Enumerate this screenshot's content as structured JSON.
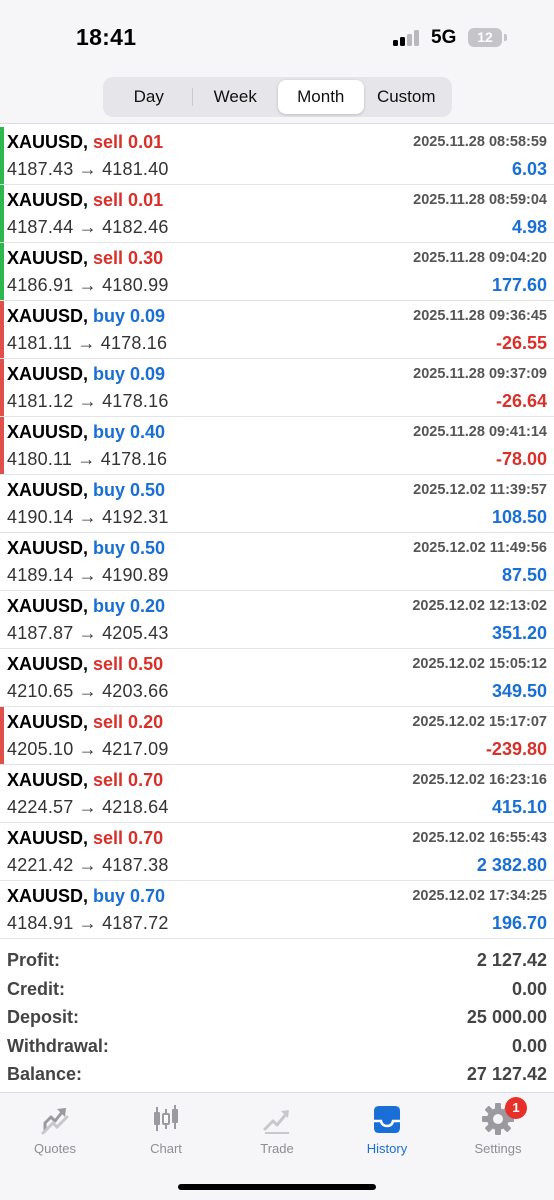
{
  "status_bar": {
    "time": "18:41",
    "network": "5G",
    "battery": "12"
  },
  "period_tabs": [
    {
      "label": "Day",
      "active": false
    },
    {
      "label": "Week",
      "active": false
    },
    {
      "label": "Month",
      "active": true
    },
    {
      "label": "Custom",
      "active": false
    }
  ],
  "deals": [
    {
      "symbol": "XAUUSD",
      "type_volume": "sell 0.01",
      "type": "sell",
      "prices": "4187.43 → 4181.40",
      "date": "2025.11.28 08:58:59",
      "profit": "6.03",
      "profit_sign": "pos",
      "side_color": "#2db84d"
    },
    {
      "symbol": "XAUUSD",
      "type_volume": "sell 0.01",
      "type": "sell",
      "prices": "4187.44 → 4182.46",
      "date": "2025.11.28 08:59:04",
      "profit": "4.98",
      "profit_sign": "pos",
      "side_color": "#2db84d"
    },
    {
      "symbol": "XAUUSD",
      "type_volume": "sell 0.30",
      "type": "sell",
      "prices": "4186.91 → 4180.99",
      "date": "2025.11.28 09:04:20",
      "profit": "177.60",
      "profit_sign": "pos",
      "side_color": "#2db84d"
    },
    {
      "symbol": "XAUUSD",
      "type_volume": "buy 0.09",
      "type": "buy",
      "prices": "4181.11 → 4178.16",
      "date": "2025.11.28 09:36:45",
      "profit": "-26.55",
      "profit_sign": "neg",
      "side_color": "#e0504a"
    },
    {
      "symbol": "XAUUSD",
      "type_volume": "buy 0.09",
      "type": "buy",
      "prices": "4181.12 → 4178.16",
      "date": "2025.11.28 09:37:09",
      "profit": "-26.64",
      "profit_sign": "neg",
      "side_color": "#e0504a"
    },
    {
      "symbol": "XAUUSD",
      "type_volume": "buy 0.40",
      "type": "buy",
      "prices": "4180.11 → 4178.16",
      "date": "2025.11.28 09:41:14",
      "profit": "-78.00",
      "profit_sign": "neg",
      "side_color": "#e0504a"
    },
    {
      "symbol": "XAUUSD",
      "type_volume": "buy 0.50",
      "type": "buy",
      "prices": "4190.14 → 4192.31",
      "date": "2025.12.02 11:39:57",
      "profit": "108.50",
      "profit_sign": "pos",
      "side_color": ""
    },
    {
      "symbol": "XAUUSD",
      "type_volume": "buy 0.50",
      "type": "buy",
      "prices": "4189.14 → 4190.89",
      "date": "2025.12.02 11:49:56",
      "profit": "87.50",
      "profit_sign": "pos",
      "side_color": ""
    },
    {
      "symbol": "XAUUSD",
      "type_volume": "buy 0.20",
      "type": "buy",
      "prices": "4187.87 → 4205.43",
      "date": "2025.12.02 12:13:02",
      "profit": "351.20",
      "profit_sign": "pos",
      "side_color": ""
    },
    {
      "symbol": "XAUUSD",
      "type_volume": "sell 0.50",
      "type": "sell",
      "prices": "4210.65 → 4203.66",
      "date": "2025.12.02 15:05:12",
      "profit": "349.50",
      "profit_sign": "pos",
      "side_color": ""
    },
    {
      "symbol": "XAUUSD",
      "type_volume": "sell 0.20",
      "type": "sell",
      "prices": "4205.10 → 4217.09",
      "date": "2025.12.02 15:17:07",
      "profit": "-239.80",
      "profit_sign": "neg",
      "side_color": "#e0504a"
    },
    {
      "symbol": "XAUUSD",
      "type_volume": "sell 0.70",
      "type": "sell",
      "prices": "4224.57 → 4218.64",
      "date": "2025.12.02 16:23:16",
      "profit": "415.10",
      "profit_sign": "pos",
      "side_color": ""
    },
    {
      "symbol": "XAUUSD",
      "type_volume": "sell 0.70",
      "type": "sell",
      "prices": "4221.42 → 4187.38",
      "date": "2025.12.02 16:55:43",
      "profit": "2 382.80",
      "profit_sign": "pos",
      "side_color": ""
    },
    {
      "symbol": "XAUUSD",
      "type_volume": "buy 0.70",
      "type": "buy",
      "prices": "4184.91 → 4187.72",
      "date": "2025.12.02 17:34:25",
      "profit": "196.70",
      "profit_sign": "pos",
      "side_color": ""
    }
  ],
  "summary": [
    {
      "label": "Profit:",
      "value": "2 127.42"
    },
    {
      "label": "Credit:",
      "value": "0.00"
    },
    {
      "label": "Deposit:",
      "value": "25 000.00"
    },
    {
      "label": "Withdrawal:",
      "value": "0.00"
    },
    {
      "label": "Balance:",
      "value": "27 127.42"
    }
  ],
  "tab_bar": [
    {
      "label": "Quotes",
      "icon": "quotes-icon",
      "active": false
    },
    {
      "label": "Chart",
      "icon": "chart-icon",
      "active": false
    },
    {
      "label": "Trade",
      "icon": "trade-icon",
      "active": false
    },
    {
      "label": "History",
      "icon": "history-icon",
      "active": true
    },
    {
      "label": "Settings",
      "icon": "settings-icon",
      "active": false,
      "badge": "1"
    }
  ],
  "colors": {
    "accent": "#1a6fd6",
    "negative": "#d9302a",
    "tab_inactive": "#8e8e93"
  }
}
